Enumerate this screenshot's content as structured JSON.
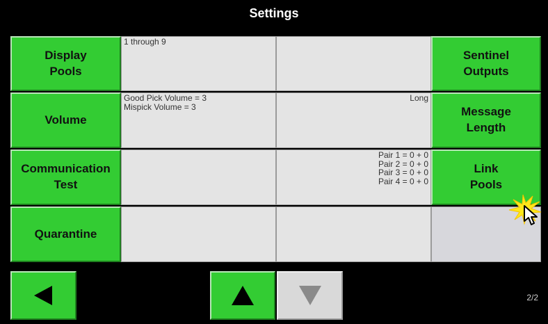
{
  "window": {
    "title": "Settings"
  },
  "buttons": {
    "display_pools": "Display\nPools",
    "volume": "Volume",
    "communication_test": "Communication\nTest",
    "quarantine": "Quarantine",
    "sentinel_outputs": "Sentinel\nOutputs",
    "message_length": "Message\nLength",
    "link_pools": "Link\nPools"
  },
  "info": {
    "display_pools_value": "1 through 9",
    "volume_value": "Good Pick Volume = 3\nMispick Volume = 3",
    "message_length_value": "Long",
    "link_pools_value": "Pair 1 = 0 + 0\nPair 2 = 0 + 0\nPair 3 = 0 + 0\nPair 4 = 0 + 0"
  },
  "navigation": {
    "back_icon": "triangle-left-icon",
    "up_icon": "triangle-up-icon",
    "down_icon": "triangle-down-icon",
    "up_enabled": true,
    "down_enabled": false,
    "page_indicator": "2/2"
  },
  "colors": {
    "button_green": "#33cc33",
    "info_gray": "#e4e4e4",
    "background": "#000000"
  }
}
